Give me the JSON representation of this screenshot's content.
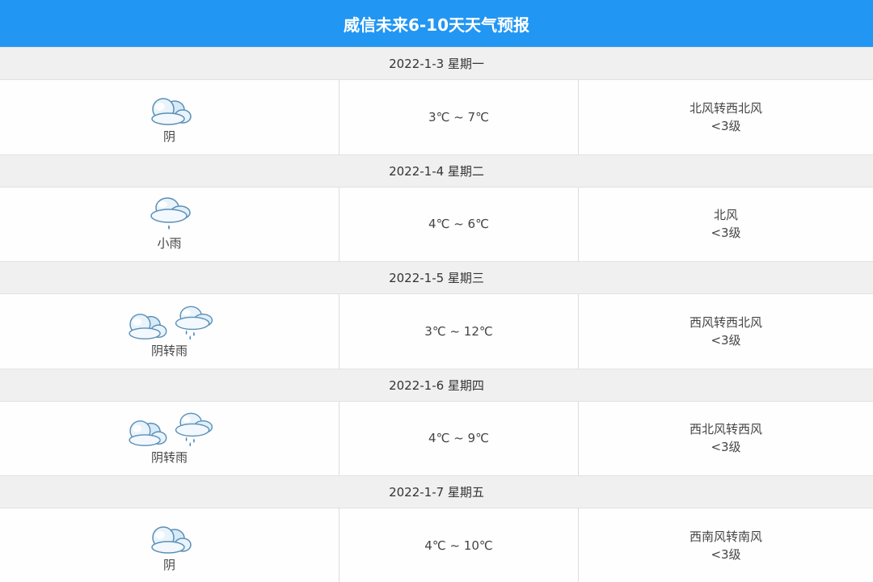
{
  "title": "威信未来6-10天天气预报",
  "days": [
    {
      "date": "2022-1-3 星期一",
      "condition": "阴",
      "icons": [
        "overcast-icon"
      ],
      "temp": "3℃ ~ 7℃",
      "wind_dir": "北风转西北风",
      "wind_level": "<3级"
    },
    {
      "date": "2022-1-4 星期二",
      "condition": "小雨",
      "icons": [
        "light-rain-icon"
      ],
      "temp": "4℃ ~ 6℃",
      "wind_dir": "北风",
      "wind_level": "<3级"
    },
    {
      "date": "2022-1-5 星期三",
      "condition": "阴转雨",
      "icons": [
        "overcast-icon",
        "rain-icon"
      ],
      "temp": "3℃ ~ 12℃",
      "wind_dir": "西风转西北风",
      "wind_level": "<3级"
    },
    {
      "date": "2022-1-6 星期四",
      "condition": "阴转雨",
      "icons": [
        "overcast-icon",
        "rain-icon"
      ],
      "temp": "4℃ ~ 9℃",
      "wind_dir": "西北风转西风",
      "wind_level": "<3级"
    },
    {
      "date": "2022-1-7 星期五",
      "condition": "阴",
      "icons": [
        "overcast-icon"
      ],
      "temp": "4℃ ~ 10℃",
      "wind_dir": "西南风转南风",
      "wind_level": "<3级"
    }
  ]
}
